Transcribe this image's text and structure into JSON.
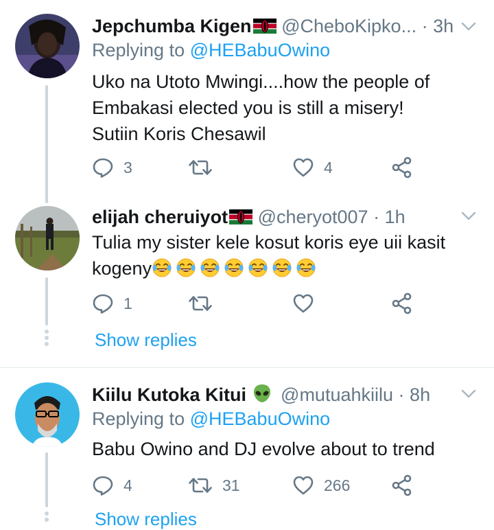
{
  "tweets": [
    {
      "name": "Jepchumba Kigen",
      "handle": "@CheboKipko...",
      "time": "3h",
      "replying_prefix": "Replying to",
      "replying_to": "@HEBabuOwino",
      "lines": [
        "Uko na Utoto Mwingi....how the people of",
        "Embakasi elected you is still a misery!",
        "Sutiin Koris Chesawil"
      ],
      "replies": "3",
      "retweets": "",
      "likes": "4"
    },
    {
      "name": "elijah cheruiyot",
      "handle": "@cheryot007",
      "time": "1h",
      "lines": [
        "Tulia my sister kele kosut koris eye uii kasit",
        "kogeny"
      ],
      "replies": "1",
      "retweets": "",
      "likes": "",
      "show_replies": "Show replies"
    },
    {
      "name": "Kiilu Kutoka Kitui",
      "handle": "@mutuahkiilu",
      "time": "8h",
      "replying_prefix": "Replying to",
      "replying_to": "@HEBabuOwino",
      "lines": [
        "Babu Owino and DJ evolve about to trend"
      ],
      "replies": "4",
      "retweets": "31",
      "likes": "266",
      "show_replies": "Show replies"
    }
  ],
  "sep": "·",
  "icons": {
    "reply": "reply-icon",
    "retweet": "retweet-icon",
    "like": "heart-icon",
    "share": "share-icon",
    "more": "chevron-down-icon",
    "flag": "kenya-flag-icon",
    "alien": "alien-emoji",
    "laugh": "tears-of-joy-emoji"
  },
  "colors": {
    "link": "#1da1f2",
    "secondary": "#657786",
    "thread_line": "#ccd6dd"
  }
}
